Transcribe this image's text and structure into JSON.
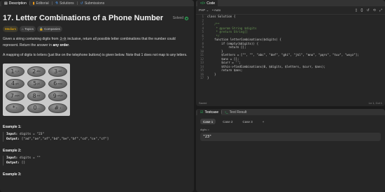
{
  "left_tabs": [
    {
      "label": "Description",
      "icon": "description-icon"
    },
    {
      "label": "Editorial",
      "icon": "book-icon"
    },
    {
      "label": "Solutions",
      "icon": "flask-icon"
    },
    {
      "label": "Submissions",
      "icon": "history-icon"
    }
  ],
  "problem": {
    "title": "17. Letter Combinations of a Phone Number",
    "status": "Solved",
    "difficulty": "Medium",
    "topics": "Topics",
    "companies": "Companies",
    "desc1_pre": "Given a string containing digits from ",
    "desc1_code": "2-9",
    "desc1_mid": " inclusive, return all possible letter combinations that the number could represent. Return the answer in ",
    "desc1_bold": "any order",
    "desc1_post": ".",
    "desc2": "A mapping of digits to letters (just like on the telephone buttons) is given below. Note that 1 does not map to any letters."
  },
  "keypad": [
    {
      "n": "1",
      "l": "o_o"
    },
    {
      "n": "2",
      "l": "abc"
    },
    {
      "n": "3",
      "l": "def"
    },
    {
      "n": "4",
      "l": "ghi"
    },
    {
      "n": "5",
      "l": "jkl"
    },
    {
      "n": "6",
      "l": "mno"
    },
    {
      "n": "7",
      "l": "pqrs"
    },
    {
      "n": "8",
      "l": "tuv"
    },
    {
      "n": "9",
      "l": "wxyz"
    },
    {
      "n": "*",
      "l": "+"
    },
    {
      "n": "0",
      "l": "⌴"
    },
    {
      "n": "#",
      "l": "⇧"
    }
  ],
  "examples": [
    {
      "title": "Example 1:",
      "input": "digits = \"23\"",
      "output": "[\"ad\",\"ae\",\"af\",\"bd\",\"be\",\"bf\",\"cd\",\"ce\",\"cf\"]"
    },
    {
      "title": "Example 2:",
      "input": "digits = \"\"",
      "output": "[]"
    },
    {
      "title": "Example 3:"
    }
  ],
  "labels": {
    "input": "Input:",
    "output": "Output:"
  },
  "code_panel": {
    "title": "Code",
    "language": "PHP",
    "mode": "Auto",
    "saved": "Saved",
    "position": "Ln 1, Col 1"
  },
  "code_lines": [
    "class Solution {",
    "",
    "    /**",
    "     * @param String $digits",
    "     * @return String[]",
    "     */",
    "    function letterCombinations($digits) {",
    "        if (empty($digits)) {",
    "            return [];",
    "        }",
    "        $letters = [\"\", \"\", \"abc\", \"def\", \"ghi\", \"jkl\", \"mno\", \"pqrs\", \"tuv\", \"wxyz\"];",
    "        $ans = [];",
    "        $curr = '';",
    "        $this->findCombinations(0, $digits, $letters, $curr, $ans);",
    "        return $ans;",
    "    }",
    "}"
  ],
  "test_panel": {
    "tabs": [
      "Testcase",
      "Test Result"
    ],
    "cases": [
      "Case 1",
      "Case 2",
      "Case 3"
    ],
    "add": "+",
    "var_label": "digits =",
    "value": "\"23\""
  },
  "colors": {
    "bg": "#1a1a1a",
    "panel": "#262626",
    "medium": "#ffb800",
    "solved": "#2cbb5d"
  }
}
